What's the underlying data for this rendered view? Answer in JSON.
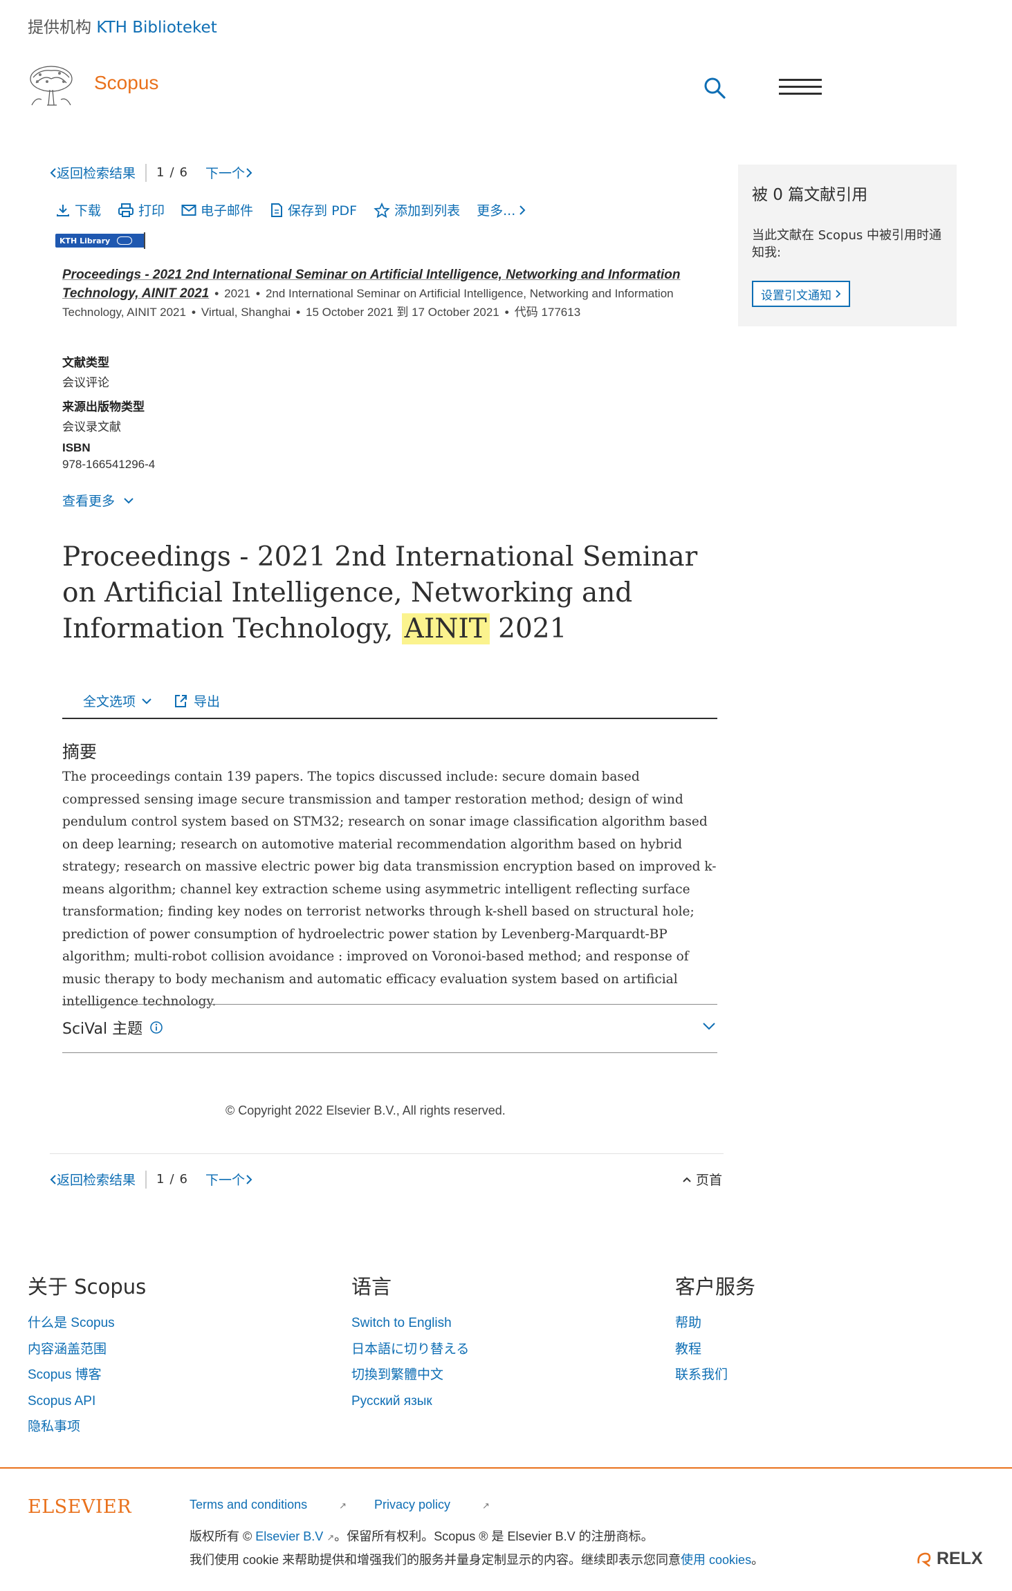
{
  "institution": {
    "prefix": "提供机构",
    "name": "KTH Biblioteket"
  },
  "header": {
    "brand": "Scopus"
  },
  "nav": {
    "back": "返回检索结果",
    "current": "1",
    "slash": "/",
    "total": "6",
    "next": "下一个"
  },
  "toolbar": {
    "download": "下载",
    "print": "打印",
    "email": "电子邮件",
    "save_pdf": "保存到 PDF",
    "add_list": "添加到列表",
    "more": "更多..."
  },
  "badge": {
    "label": "KTH Library"
  },
  "source": {
    "title": "Proceedings - 2021 2nd International Seminar on Artificial Intelligence, Networking and Information Technology, AINIT 2021",
    "year": "2021",
    "conference": "2nd International Seminar on Artificial Intelligence, Networking and Information Technology, AINIT 2021",
    "location": "Virtual, Shanghai",
    "dates": "15 October 2021 到 17 October 2021",
    "code": "代码 177613"
  },
  "meta": {
    "doc_type_label": "文献类型",
    "doc_type": "会议评论",
    "source_type_label": "来源出版物类型",
    "source_type": "会议录文献",
    "isbn_label": "ISBN",
    "isbn": "978-166541296-4",
    "view_more": "查看更多"
  },
  "doc": {
    "title_before": "Proceedings - 2021 2nd International Seminar on Artificial Intelligence, Networking and Information Technology, ",
    "title_highlight": "AINIT",
    "title_after": " 2021"
  },
  "actions": {
    "full_text": "全文选项",
    "export": "导出"
  },
  "abstract": {
    "heading": "摘要",
    "text": "The proceedings contain 139 papers. The topics discussed include: secure domain based compressed sensing image secure transmission and tamper restoration method; design of wind pendulum control system based on STM32; research on sonar image classification algorithm based on deep learning; research on automotive material recommendation algorithm based on hybrid strategy; research on massive electric power big data transmission encryption based on improved k-means algorithm; channel key extraction scheme using asymmetric intelligent reflecting surface transformation; finding key nodes on terrorist networks through k-shell based on structural hole; prediction of power consumption of hydroelectric power station by Levenberg-Marquardt-BP algorithm; multi-robot collision avoidance : improved on Voronoi-based method; and response of music therapy to body mechanism and automatic efficacy evaluation system based on artificial intelligence technology."
  },
  "scival": {
    "label": "SciVal 主题"
  },
  "copyright": "© Copyright 2022 Elsevier B.V., All rights reserved.",
  "top_link": "页首",
  "citations": {
    "heading": "被 0 篇文献引用",
    "text": "当此文献在 Scopus 中被引用时通知我:",
    "button": "设置引文通知"
  },
  "footer": {
    "about": {
      "heading": "关于 Scopus",
      "links": [
        "什么是 Scopus",
        "内容涵盖范围",
        "Scopus 博客",
        "Scopus API",
        "隐私事项"
      ]
    },
    "language": {
      "heading": "语言",
      "links": [
        "Switch to English",
        "日本語に切り替える",
        "切換到繁體中文",
        "Русский язык"
      ]
    },
    "service": {
      "heading": "客户服务",
      "links": [
        "帮助",
        "教程",
        "联系我们"
      ]
    },
    "elsevier": "ELSEVIER",
    "terms": "Terms and conditions",
    "privacy": "Privacy policy",
    "rights_a": "版权所有 ©",
    "rights_link": "Elsevier B.V",
    "rights_b": "。保留所有权利。Scopus ® 是 Elsevier B.V 的注册商标。",
    "cookie_a": "我们使用 cookie 来帮助提供和增强我们的服务并量身定制显示的内容。继续即表示您同意",
    "cookie_link": "使用 cookies",
    "cookie_b": "。",
    "relx": "RELX"
  },
  "colors": {
    "link": "#0e6eb4",
    "brand": "#e9711c",
    "highlight": "#fbf38e",
    "panel": "#f3f3f3"
  }
}
